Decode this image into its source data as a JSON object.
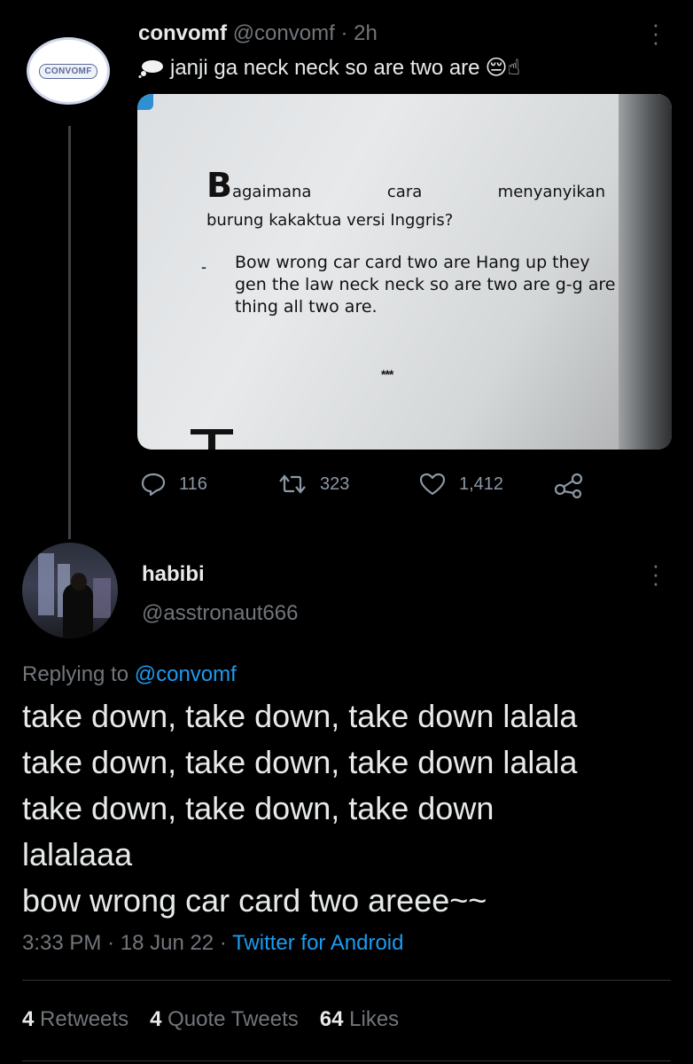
{
  "parent_tweet": {
    "avatar_text": "CONVOMF",
    "name": "convomf",
    "handle": "@convomf",
    "separator": "·",
    "time": "2h",
    "text": "janji ga neck neck so are two are",
    "text_emoji": "😔☝",
    "image": {
      "heading_initial": "B",
      "heading_word1": "agaimana",
      "heading_word2": "cara",
      "heading_word3": "menyanyikan",
      "heading_line2": "burung kakaktua versi Inggris?",
      "bullet": "-",
      "answer": "Bow wrong car card two are Hang up they gen the law neck neck so are two are g-g are thing all two are.",
      "stars": "***"
    },
    "actions": {
      "reply_count": "116",
      "retweet_count": "323",
      "like_count": "1,412"
    }
  },
  "reply_tweet": {
    "name": "habibi",
    "handle": "@asstronaut666",
    "replying_prefix": "Replying to",
    "replying_to": "@convomf",
    "lines": [
      "take down, take down, take down lalala",
      "take down, take down, take down lalala",
      "take down, take down, take down",
      "lalalaaa",
      "bow wrong car card two areee~~"
    ],
    "time": "3:33 PM",
    "date": "18 Jun 22",
    "separator": "·",
    "source": "Twitter for Android",
    "stats": {
      "retweets_count": "4",
      "retweets_label": "Retweets",
      "quotes_count": "4",
      "quotes_label": "Quote Tweets",
      "likes_count": "64",
      "likes_label": "Likes"
    }
  },
  "colors": {
    "background": "#000000",
    "text": "#e7e9ea",
    "muted": "#71767b",
    "link": "#1d9bf0",
    "divider": "#2f3336"
  }
}
